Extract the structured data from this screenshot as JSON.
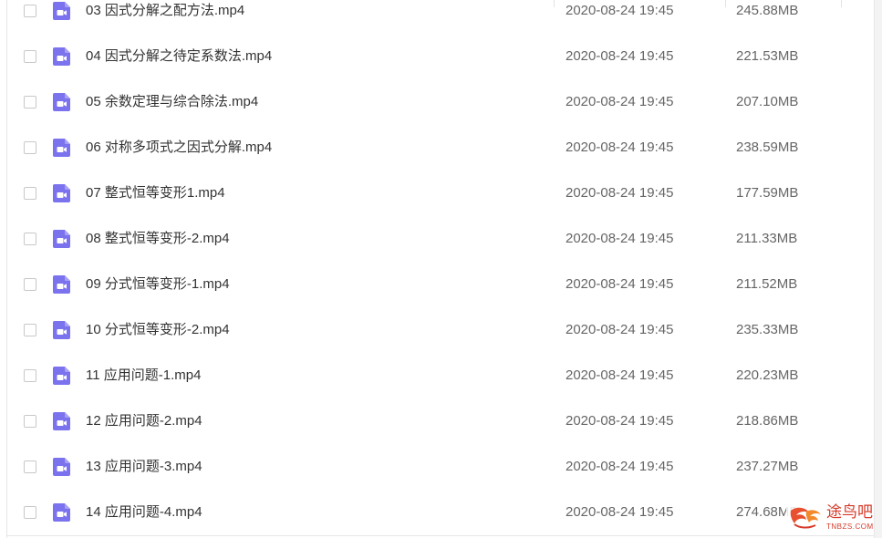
{
  "files": [
    {
      "name": "03 因式分解之配方法.mp4",
      "date": "2020-08-24 19:45",
      "size": "245.88MB"
    },
    {
      "name": "04 因式分解之待定系数法.mp4",
      "date": "2020-08-24 19:45",
      "size": "221.53MB"
    },
    {
      "name": "05 余数定理与综合除法.mp4",
      "date": "2020-08-24 19:45",
      "size": "207.10MB"
    },
    {
      "name": "06 对称多项式之因式分解.mp4",
      "date": "2020-08-24 19:45",
      "size": "238.59MB"
    },
    {
      "name": "07 整式恒等变形1.mp4",
      "date": "2020-08-24 19:45",
      "size": "177.59MB"
    },
    {
      "name": "08 整式恒等变形-2.mp4",
      "date": "2020-08-24 19:45",
      "size": "211.33MB"
    },
    {
      "name": "09 分式恒等变形-1.mp4",
      "date": "2020-08-24 19:45",
      "size": "211.52MB"
    },
    {
      "name": "10 分式恒等变形-2.mp4",
      "date": "2020-08-24 19:45",
      "size": "235.33MB"
    },
    {
      "name": "11 应用问题-1.mp4",
      "date": "2020-08-24 19:45",
      "size": "220.23MB"
    },
    {
      "name": "12 应用问题-2.mp4",
      "date": "2020-08-24 19:45",
      "size": "218.86MB"
    },
    {
      "name": "13 应用问题-3.mp4",
      "date": "2020-08-24 19:45",
      "size": "237.27MB"
    },
    {
      "name": "14 应用问题-4.mp4",
      "date": "2020-08-24 19:45",
      "size": "274.68MB"
    }
  ],
  "file_icon": "video-file-icon",
  "colors": {
    "icon_purple": "#7b72ee",
    "text_primary": "#333333",
    "text_secondary": "#666666",
    "watermark_red": "#d63a2a"
  },
  "watermark": {
    "title": "途鸟吧",
    "subtitle": "TNBZS.COM"
  }
}
